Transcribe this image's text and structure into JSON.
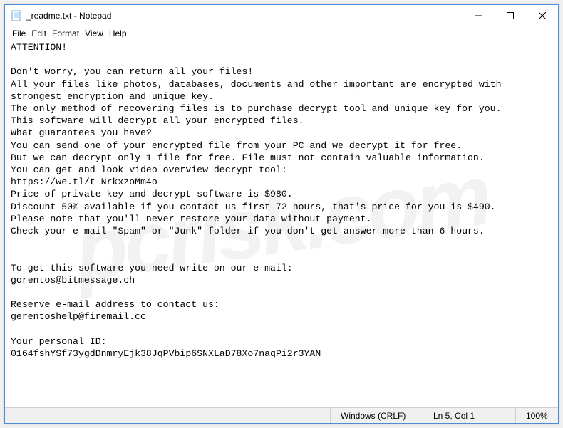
{
  "window": {
    "title": "_readme.txt - Notepad"
  },
  "menu": {
    "file": "File",
    "edit": "Edit",
    "format": "Format",
    "view": "View",
    "help": "Help"
  },
  "content": {
    "text": "ATTENTION!\n\nDon't worry, you can return all your files!\nAll your files like photos, databases, documents and other important are encrypted with strongest encryption and unique key.\nThe only method of recovering files is to purchase decrypt tool and unique key for you.\nThis software will decrypt all your encrypted files.\nWhat guarantees you have?\nYou can send one of your encrypted file from your PC and we decrypt it for free.\nBut we can decrypt only 1 file for free. File must not contain valuable information.\nYou can get and look video overview decrypt tool:\nhttps://we.tl/t-NrkxzoMm4o\nPrice of private key and decrypt software is $980.\nDiscount 50% available if you contact us first 72 hours, that's price for you is $490.\nPlease note that you'll never restore your data without payment.\nCheck your e-mail \"Spam\" or \"Junk\" folder if you don't get answer more than 6 hours.\n\n\nTo get this software you need write on our e-mail:\ngorentos@bitmessage.ch\n\nReserve e-mail address to contact us:\ngerentoshelp@firemail.cc\n\nYour personal ID:\n0164fshYSf73ygdDnmryEjk38JqPVbip6SNXLaD78Xo7naqPi2r3YAN"
  },
  "statusbar": {
    "encoding": "Windows (CRLF)",
    "position": "Ln 5, Col 1",
    "zoom": "100%"
  },
  "watermark": "pcrisk.com"
}
